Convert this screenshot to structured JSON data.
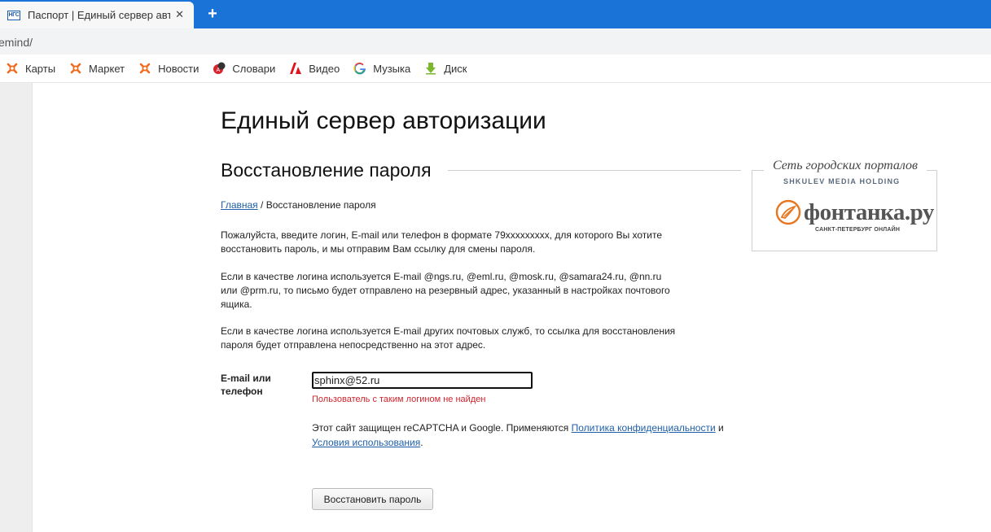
{
  "browser": {
    "tab_title": "Паспорт | Единый сервер авторизации",
    "tab_favicon_text": "НГС",
    "url": "emind/",
    "bookmarks": [
      {
        "label": "Карты",
        "icon": "yandex-maps-icon"
      },
      {
        "label": "Маркет",
        "icon": "yandex-market-icon"
      },
      {
        "label": "Новости",
        "icon": "yandex-news-icon"
      },
      {
        "label": "Словари",
        "icon": "dictionary-icon"
      },
      {
        "label": "Видео",
        "icon": "video-icon"
      },
      {
        "label": "Музыка",
        "icon": "google-icon"
      },
      {
        "label": "Диск",
        "icon": "disk-icon"
      }
    ]
  },
  "page": {
    "title": "Единый сервер авторизации",
    "subtitle": "Восстановление пароля",
    "breadcrumb": {
      "home": "Главная",
      "separator": " / ",
      "current": "Восстановление пароля"
    },
    "paragraphs": [
      "Пожалуйста, введите логин, E-mail или телефон в формате 79xxxxxxxxx, для которого Вы хотите восстановить пароль, и мы отправим Вам ссылку для смены пароля.",
      "Если в качестве логина используется E-mail @ngs.ru, @eml.ru, @mosk.ru, @samara24.ru, @nn.ru или @prm.ru, то письмо будет отправлено на резервный адрес, указанный в настройках почтового ящика.",
      "Если в качестве логина используется E-mail других почтовых служб, то ссылка для восстановления пароля будет отправлена непосредственно на этот адрес."
    ],
    "form": {
      "label": "E-mail или телефон",
      "value": "sphinx@52.ru",
      "error": "Пользователь с таким логином не найден",
      "recaptcha_text": "Этот сайт защищен reCAPTCHA и Google. Применяются ",
      "privacy_link": "Политика конфиденциальности",
      "and": " и ",
      "terms_link": "Условия использования",
      "period": ".",
      "submit": "Восстановить пароль"
    },
    "portal": {
      "header": "Сеть городских порталов",
      "holding": "SHKULEV MEDIA HOLDING",
      "brand": "фонтанка.ру",
      "tagline": "САНКТ-ПЕТЕРБУРГ ОНЛАЙН"
    }
  },
  "colors": {
    "tabstrip": "#1a73d6",
    "link": "#1f5fa8",
    "error": "#d0252e",
    "fontanka_orange": "#e8761f"
  }
}
